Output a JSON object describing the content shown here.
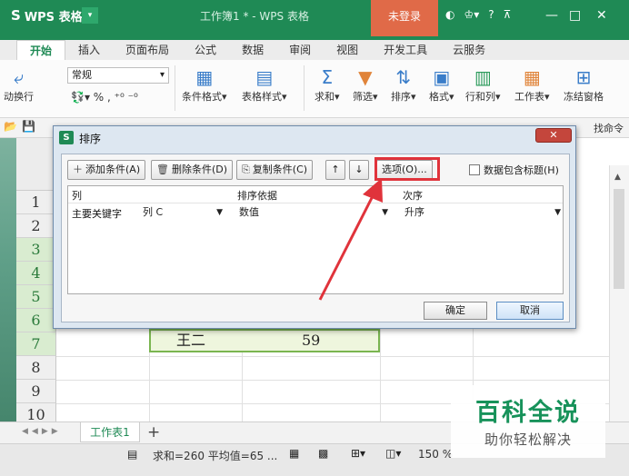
{
  "titlebar": {
    "app_name": "WPS 表格",
    "app_logo": "S",
    "window_title": "工作簿1 * - WPS 表格",
    "login_label": "未登录",
    "help_label": "?",
    "minimize": "—",
    "maximize": "□",
    "close": "✕"
  },
  "ribbon_tabs": [
    "开始",
    "插入",
    "页面布局",
    "公式",
    "数据",
    "审阅",
    "视图",
    "开发工具",
    "云服务"
  ],
  "ribbon": {
    "wrap_label": "动换行",
    "font_value": "常规",
    "number_format": "% ,",
    "cond_format": "条件格式",
    "table_style": "表格样式",
    "sum": "求和",
    "filter": "筛选",
    "sort": "排序",
    "format": "格式",
    "rows_cols": "行和列",
    "worksheet": "工作表",
    "freeze": "冻结窗格"
  },
  "quickbar": {
    "find_cmd": "找命令"
  },
  "grid": {
    "rows": [
      "1",
      "2",
      "3",
      "4",
      "5",
      "6",
      "7",
      "8",
      "9",
      "10"
    ],
    "row7_name": "王二",
    "row7_score": "59"
  },
  "sheetbar": {
    "sheet_name": "工作表1",
    "add": "+"
  },
  "status": {
    "summary": "求和=260 平均值=65 ...",
    "zoom": "150 %"
  },
  "watermark": {
    "title": "百科全说",
    "subtitle": "助你轻松解决"
  },
  "dialog": {
    "title": "排序",
    "close": "✕",
    "add_condition": "添加条件(A)",
    "delete_condition": "删除条件(D)",
    "copy_condition": "复制条件(C)",
    "move_up": "↑",
    "move_down": "↓",
    "options": "选项(O)...",
    "has_header_label": "数据包含标题(H)",
    "has_header_checked": false,
    "headers": {
      "column": "列",
      "sort_on": "排序依据",
      "order": "次序"
    },
    "criteria": {
      "key_label": "主要关键字",
      "column_value": "列 C",
      "sort_on_value": "数值",
      "order_value": "升序"
    },
    "ok": "确定",
    "cancel": "取消"
  },
  "colors": {
    "brand": "#1f8a55",
    "highlight": "#e0333b",
    "arrow": "#e0333b"
  }
}
